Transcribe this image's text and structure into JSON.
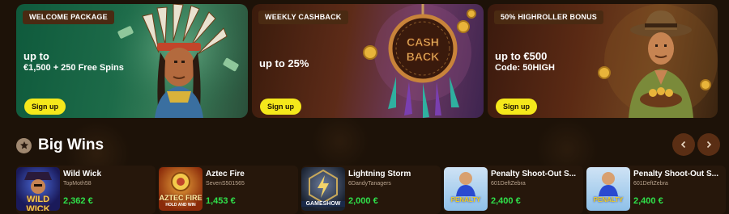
{
  "promos": [
    {
      "tag": "WELCOME PACKAGE",
      "line1": "up to",
      "line2": "€1,500 + 250 Free Spins",
      "button": "Sign up"
    },
    {
      "tag": "WEEKLY CASHBACK",
      "line1": "up to 25%",
      "line2": "",
      "button": "Sign up",
      "art_text": "CASH BACK"
    },
    {
      "tag": "50% HIGHROLLER BONUS",
      "line1": "up to €500",
      "line2": "Code: 50HIGH",
      "button": "Sign up"
    }
  ],
  "big_wins": {
    "title": "Big Wins",
    "items": [
      {
        "game": "Wild Wick",
        "user": "TopMoth58",
        "amount": "2,362 €",
        "thumb_text": "WILD WICK"
      },
      {
        "game": "Aztec Fire",
        "user": "SevenS501565",
        "amount": "1,453 €",
        "thumb_text": "AZTEC FIRE",
        "thumb_sub": "HOLD AND WIN"
      },
      {
        "game": "Lightning Storm",
        "user": "6DandyTanagers",
        "amount": "2,000 €",
        "thumb_text": "GAMESHOW"
      },
      {
        "game": "Penalty Shoot-Out S...",
        "user": "601DeftZebra",
        "amount": "2,400 €",
        "thumb_text": "PENALTY"
      },
      {
        "game": "Penalty Shoot-Out S...",
        "user": "601DeftZebra",
        "amount": "2,400 €",
        "thumb_text": "PENALTY"
      }
    ]
  },
  "colors": {
    "accent_yellow": "#f5e81b",
    "amount_green": "#2fe04a",
    "background": "#1d1208"
  },
  "icons": {
    "section": "star-icon",
    "prev": "chevron-left-icon",
    "next": "chevron-right-icon"
  }
}
